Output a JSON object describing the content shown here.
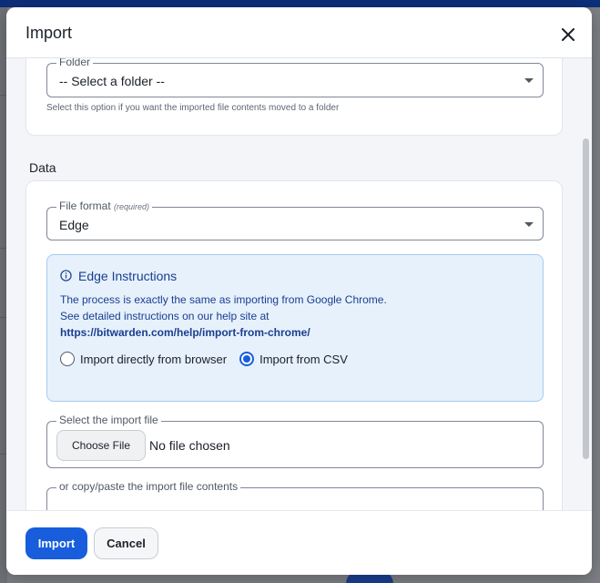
{
  "dialog": {
    "title": "Import",
    "close_icon": "close-icon"
  },
  "folder_field": {
    "label": "Folder",
    "value": "-- Select a folder --",
    "help": "Select this option if you want the imported file contents moved to a folder"
  },
  "data_section": {
    "heading": "Data",
    "file_format": {
      "label": "File format",
      "required": "(required)",
      "value": "Edge"
    },
    "callout": {
      "icon": "info-circle-icon",
      "title": "Edge Instructions",
      "line1": "The process is exactly the same as importing from Google Chrome.",
      "line2": "See detailed instructions on our help site at",
      "link": "https://bitwarden.com/help/import-from-chrome/",
      "options": [
        {
          "label": "Import directly from browser",
          "selected": false
        },
        {
          "label": "Import from CSV",
          "selected": true
        }
      ]
    },
    "import_file": {
      "label": "Select the import file",
      "button": "Choose File",
      "status": "No file chosen"
    },
    "paste": {
      "label": "or copy/paste the import file contents"
    }
  },
  "footer": {
    "import_label": "Import",
    "cancel_label": "Cancel"
  },
  "colors": {
    "primary": "#175ddc",
    "callout_bg": "#e6f1fc",
    "callout_text": "#1a3e8f"
  }
}
